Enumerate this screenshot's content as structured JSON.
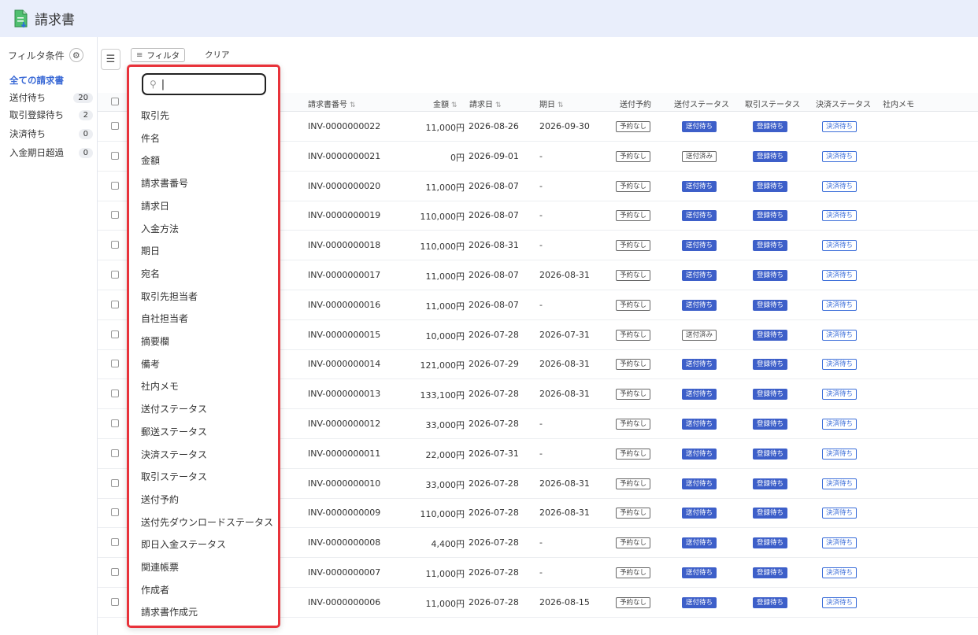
{
  "header": {
    "title": "請求書",
    "icon": "document-icon"
  },
  "sidebar": {
    "heading": "フィルタ条件",
    "items": [
      {
        "label": "全ての請求書",
        "count": ""
      },
      {
        "label": "送付待ち",
        "count": "20"
      },
      {
        "label": "取引登録待ち",
        "count": "2"
      },
      {
        "label": "決済待ち",
        "count": "0"
      },
      {
        "label": "入金期日超過",
        "count": "0"
      }
    ]
  },
  "toolbar": {
    "filter_label": "フィルタ",
    "clear_label": "クリア"
  },
  "table": {
    "columns": [
      "請求書番号",
      "金額",
      "請求日",
      "期日",
      "送付予約",
      "送付ステータス",
      "取引ステータス",
      "決済ステータス",
      "社内メモ"
    ],
    "rows": [
      {
        "no": "INV-0000000022",
        "amount": "11,000円",
        "date": "2026-08-26",
        "due": "2026-09-30",
        "reserve": "予約なし",
        "send": "送付待ち",
        "deal": "登録待ち",
        "settle": "決済待ち"
      },
      {
        "no": "INV-0000000021",
        "amount": "0円",
        "date": "2026-09-01",
        "due": "-",
        "reserve": "予約なし",
        "send": "送付済み",
        "deal": "登録待ち",
        "settle": "決済待ち"
      },
      {
        "no": "INV-0000000020",
        "amount": "11,000円",
        "date": "2026-08-07",
        "due": "-",
        "reserve": "予約なし",
        "send": "送付待ち",
        "deal": "登録待ち",
        "settle": "決済待ち"
      },
      {
        "no": "INV-0000000019",
        "amount": "110,000円",
        "date": "2026-08-07",
        "due": "-",
        "reserve": "予約なし",
        "send": "送付待ち",
        "deal": "登録待ち",
        "settle": "決済待ち"
      },
      {
        "no": "INV-0000000018",
        "amount": "110,000円",
        "date": "2026-08-31",
        "due": "-",
        "reserve": "予約なし",
        "send": "送付待ち",
        "deal": "登録待ち",
        "settle": "決済待ち"
      },
      {
        "no": "INV-0000000017",
        "amount": "11,000円",
        "date": "2026-08-07",
        "due": "2026-08-31",
        "reserve": "予約なし",
        "send": "送付待ち",
        "deal": "登録待ち",
        "settle": "決済待ち"
      },
      {
        "no": "INV-0000000016",
        "amount": "11,000円",
        "date": "2026-08-07",
        "due": "-",
        "reserve": "予約なし",
        "send": "送付待ち",
        "deal": "登録待ち",
        "settle": "決済待ち"
      },
      {
        "no": "INV-0000000015",
        "amount": "10,000円",
        "date": "2026-07-28",
        "due": "2026-07-31",
        "reserve": "予約なし",
        "send": "送付済み",
        "deal": "登録待ち",
        "settle": "決済待ち"
      },
      {
        "no": "INV-0000000014",
        "amount": "121,000円",
        "date": "2026-07-29",
        "due": "2026-08-31",
        "reserve": "予約なし",
        "send": "送付待ち",
        "deal": "登録待ち",
        "settle": "決済待ち"
      },
      {
        "no": "INV-0000000013",
        "amount": "133,100円",
        "date": "2026-07-28",
        "due": "2026-08-31",
        "reserve": "予約なし",
        "send": "送付待ち",
        "deal": "登録待ち",
        "settle": "決済待ち"
      },
      {
        "no": "INV-0000000012",
        "amount": "33,000円",
        "date": "2026-07-28",
        "due": "-",
        "reserve": "予約なし",
        "send": "送付待ち",
        "deal": "登録待ち",
        "settle": "決済待ち"
      },
      {
        "no": "INV-0000000011",
        "amount": "22,000円",
        "date": "2026-07-31",
        "due": "-",
        "reserve": "予約なし",
        "send": "送付待ち",
        "deal": "登録待ち",
        "settle": "決済待ち"
      },
      {
        "no": "INV-0000000010",
        "amount": "33,000円",
        "date": "2026-07-28",
        "due": "2026-08-31",
        "reserve": "予約なし",
        "send": "送付待ち",
        "deal": "登録待ち",
        "settle": "決済待ち"
      },
      {
        "no": "INV-0000000009",
        "amount": "110,000円",
        "date": "2026-07-28",
        "due": "2026-08-31",
        "reserve": "予約なし",
        "send": "送付待ち",
        "deal": "登録待ち",
        "settle": "決済待ち"
      },
      {
        "no": "INV-0000000008",
        "amount": "4,400円",
        "date": "2026-07-28",
        "due": "-",
        "reserve": "予約なし",
        "send": "送付待ち",
        "deal": "登録待ち",
        "settle": "決済待ち"
      },
      {
        "no": "INV-0000000007",
        "amount": "11,000円",
        "date": "2026-07-28",
        "due": "-",
        "reserve": "予約なし",
        "send": "送付待ち",
        "deal": "登録待ち",
        "settle": "決済待ち"
      },
      {
        "no": "INV-0000000006",
        "amount": "11,000円",
        "date": "2026-07-28",
        "due": "2026-08-15",
        "reserve": "予約なし",
        "send": "送付待ち",
        "deal": "登録待ち",
        "settle": "決済待ち"
      }
    ]
  },
  "dropdown": {
    "search_placeholder": "",
    "items": [
      "取引先",
      "件名",
      "金額",
      "請求書番号",
      "請求日",
      "入金方法",
      "期日",
      "宛名",
      "取引先担当者",
      "自社担当者",
      "摘要欄",
      "備考",
      "社内メモ",
      "送付ステータス",
      "郵送ステータス",
      "決済ステータス",
      "取引ステータス",
      "送付予約",
      "送付先ダウンロードステータス",
      "即日入金ステータス",
      "関連帳票",
      "作成者",
      "請求書作成元"
    ]
  },
  "colors": {
    "accent": "#3d5fc9",
    "highlight_border": "#e8323a",
    "header_bg": "#e9eefb"
  }
}
